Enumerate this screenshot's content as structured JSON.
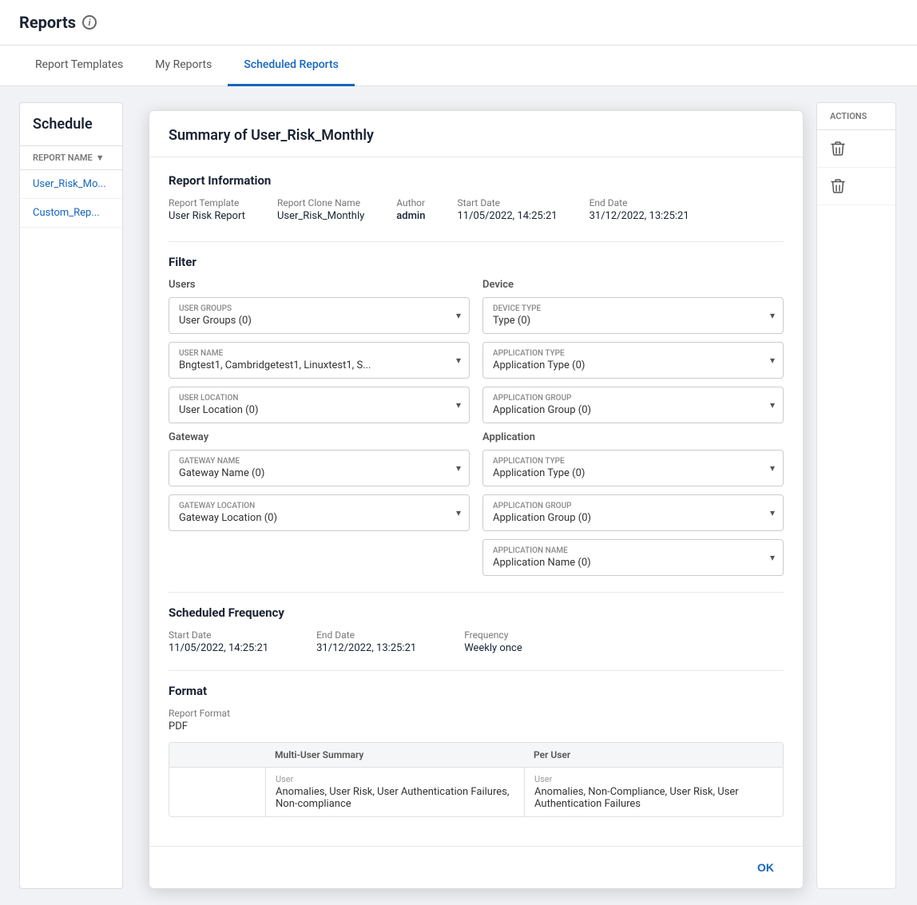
{
  "page": {
    "title": "Reports",
    "info_icon": "i"
  },
  "tabs": {
    "items": [
      {
        "label": "Report Templates",
        "active": false
      },
      {
        "label": "My Reports",
        "active": false
      },
      {
        "label": "Scheduled Reports",
        "active": true
      }
    ]
  },
  "left_panel": {
    "title": "Schedule",
    "col_header": "REPORT NAME",
    "rows": [
      {
        "label": "User_Risk_Mo..."
      },
      {
        "label": "Custom_Rep..."
      }
    ]
  },
  "modal": {
    "title": "Summary of User_Risk_Monthly",
    "report_information": {
      "section_title": "Report Information",
      "report_template_label": "Report Template",
      "report_template_value": "User Risk Report",
      "clone_name_label": "Report Clone Name",
      "clone_name_value": "User_Risk_Monthly",
      "author_label": "Author",
      "author_value": "admin",
      "start_date_label": "Start Date",
      "start_date_value": "11/05/2022, 14:25:21",
      "end_date_label": "End Date",
      "end_date_value": "31/12/2022, 13:25:21"
    },
    "filter": {
      "section_title": "Filter",
      "users_label": "Users",
      "device_label": "Device",
      "gateway_label": "Gateway",
      "application_label": "Application",
      "user_groups": {
        "label": "USER GROUPS",
        "value": "User Groups (0)"
      },
      "device_type": {
        "label": "DEVICE TYPE",
        "value": "Type (0)"
      },
      "user_name": {
        "label": "USER NAME",
        "value": "Bngtest1, Cambridgetest1, Linuxtest1, S..."
      },
      "application_type": {
        "label": "APPLICATION TYPE",
        "value": "Application Type (0)"
      },
      "user_location": {
        "label": "USER LOCATION",
        "value": "User Location (0)"
      },
      "application_group": {
        "label": "APPLICATION GROUP",
        "value": "Application Group (0)"
      },
      "gateway_name": {
        "label": "GATEWAY NAME",
        "value": "Gateway Name (0)"
      },
      "application_name": {
        "label": "APPLICATION NAME",
        "value": "Application Name (0)"
      },
      "gateway_location": {
        "label": "GATEWAY LOCATION",
        "value": "Gateway Location (0)"
      }
    },
    "scheduled_frequency": {
      "section_title": "Scheduled Frequency",
      "start_date_label": "Start Date",
      "start_date_value": "11/05/2022, 14:25:21",
      "end_date_label": "End Date",
      "end_date_value": "31/12/2022, 13:25:21",
      "frequency_label": "Frequency",
      "frequency_value": "Weekly once"
    },
    "format": {
      "section_title": "Format",
      "report_format_label": "Report Format",
      "report_format_value": "PDF",
      "multi_user_summary_label": "Multi-User Summary",
      "per_user_label": "Per User",
      "user_label": "User",
      "multi_user_items": "Anomalies, User Risk, User Authentication Failures, Non-compliance",
      "per_user_items": "Anomalies, Non-Compliance, User Risk, User Authentication Failures"
    },
    "footer": {
      "ok_label": "OK"
    }
  },
  "actions": {
    "header": "ACTIONS",
    "delete_icon_1": "🗑",
    "delete_icon_2": "🗑"
  }
}
